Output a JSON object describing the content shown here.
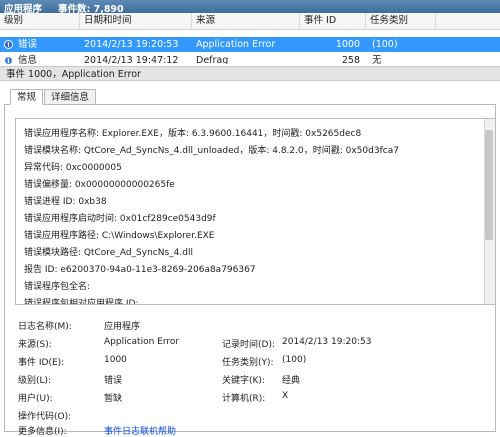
{
  "header": {
    "title": "应用程序",
    "count": "事件数: 7,890"
  },
  "columns": [
    "级别",
    "日期和时间",
    "来源",
    "事件 ID",
    "任务类别"
  ],
  "events": [
    {
      "level": "错误",
      "datetime": "2014/2/13 19:20:53",
      "source": "Application Error",
      "id": "1000",
      "category": "(100)"
    },
    {
      "level": "信息",
      "datetime": "2014/2/13 19:47:12",
      "source": "Defrag",
      "id": "258",
      "category": "无"
    }
  ],
  "detail": {
    "title": "事件 1000，Application Error",
    "tabs": [
      "常规",
      "详细信息"
    ],
    "message_lines": [
      "错误应用程序名称: Explorer.EXE，版本: 6.3.9600.16441，时间戳: 0x5265dec8",
      "错误模块名称: QtCore_Ad_SyncNs_4.dll_unloaded，版本: 4.8.2.0，时间戳: 0x50d3fca7",
      "异常代码: 0xc0000005",
      "错误偏移量: 0x00000000000265fe",
      "错误进程 ID: 0xb38",
      "错误应用程序启动时间: 0x01cf289ce0543d9f",
      "错误应用程序路径: C:\\Windows\\Explorer.EXE",
      "错误模块路径: QtCore_Ad_SyncNs_4.dll",
      "报告 ID: e6200370-94a0-11e3-8269-206a8a796367",
      "错误程序包全名:",
      "错误程序包相对应用程序 ID:"
    ],
    "props": {
      "log_name_label": "日志名称(M):",
      "log_name": "应用程序",
      "source_label": "来源(S):",
      "source": "Application Error",
      "logged_label": "记录时间(D):",
      "logged": "2014/2/13 19:20:53",
      "event_id_label": "事件 ID(E):",
      "event_id": "1000",
      "task_label": "任务类别(Y):",
      "task": "(100)",
      "level_label": "级别(L):",
      "level": "错误",
      "keywords_label": "关键字(K):",
      "keywords": "经典",
      "user_label": "用户(U):",
      "user": "暂缺",
      "computer_label": "计算机(R):",
      "computer": "X",
      "opcode_label": "操作代码(O):",
      "more_label": "更多信息(I):",
      "more_link": "事件日志联机帮助"
    }
  },
  "colors": {
    "selection": "#3399ff",
    "header": "#4a78a6",
    "link": "#0a4fd6"
  }
}
